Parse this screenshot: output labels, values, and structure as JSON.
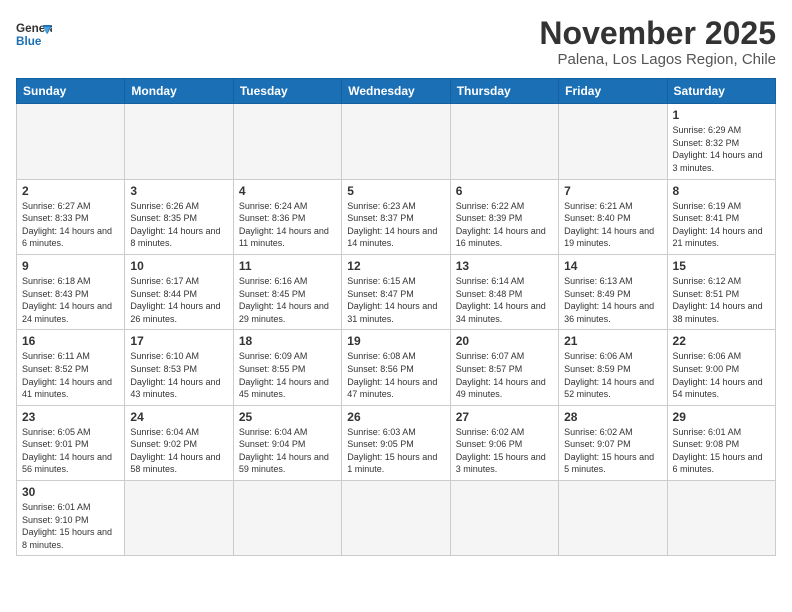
{
  "logo": {
    "general": "General",
    "blue": "Blue"
  },
  "header": {
    "month": "November 2025",
    "location": "Palena, Los Lagos Region, Chile"
  },
  "weekdays": [
    "Sunday",
    "Monday",
    "Tuesday",
    "Wednesday",
    "Thursday",
    "Friday",
    "Saturday"
  ],
  "weeks": [
    [
      {
        "day": "",
        "info": ""
      },
      {
        "day": "",
        "info": ""
      },
      {
        "day": "",
        "info": ""
      },
      {
        "day": "",
        "info": ""
      },
      {
        "day": "",
        "info": ""
      },
      {
        "day": "",
        "info": ""
      },
      {
        "day": "1",
        "info": "Sunrise: 6:29 AM\nSunset: 8:32 PM\nDaylight: 14 hours and 3 minutes."
      }
    ],
    [
      {
        "day": "2",
        "info": "Sunrise: 6:27 AM\nSunset: 8:33 PM\nDaylight: 14 hours and 6 minutes."
      },
      {
        "day": "3",
        "info": "Sunrise: 6:26 AM\nSunset: 8:35 PM\nDaylight: 14 hours and 8 minutes."
      },
      {
        "day": "4",
        "info": "Sunrise: 6:24 AM\nSunset: 8:36 PM\nDaylight: 14 hours and 11 minutes."
      },
      {
        "day": "5",
        "info": "Sunrise: 6:23 AM\nSunset: 8:37 PM\nDaylight: 14 hours and 14 minutes."
      },
      {
        "day": "6",
        "info": "Sunrise: 6:22 AM\nSunset: 8:39 PM\nDaylight: 14 hours and 16 minutes."
      },
      {
        "day": "7",
        "info": "Sunrise: 6:21 AM\nSunset: 8:40 PM\nDaylight: 14 hours and 19 minutes."
      },
      {
        "day": "8",
        "info": "Sunrise: 6:19 AM\nSunset: 8:41 PM\nDaylight: 14 hours and 21 minutes."
      }
    ],
    [
      {
        "day": "9",
        "info": "Sunrise: 6:18 AM\nSunset: 8:43 PM\nDaylight: 14 hours and 24 minutes."
      },
      {
        "day": "10",
        "info": "Sunrise: 6:17 AM\nSunset: 8:44 PM\nDaylight: 14 hours and 26 minutes."
      },
      {
        "day": "11",
        "info": "Sunrise: 6:16 AM\nSunset: 8:45 PM\nDaylight: 14 hours and 29 minutes."
      },
      {
        "day": "12",
        "info": "Sunrise: 6:15 AM\nSunset: 8:47 PM\nDaylight: 14 hours and 31 minutes."
      },
      {
        "day": "13",
        "info": "Sunrise: 6:14 AM\nSunset: 8:48 PM\nDaylight: 14 hours and 34 minutes."
      },
      {
        "day": "14",
        "info": "Sunrise: 6:13 AM\nSunset: 8:49 PM\nDaylight: 14 hours and 36 minutes."
      },
      {
        "day": "15",
        "info": "Sunrise: 6:12 AM\nSunset: 8:51 PM\nDaylight: 14 hours and 38 minutes."
      }
    ],
    [
      {
        "day": "16",
        "info": "Sunrise: 6:11 AM\nSunset: 8:52 PM\nDaylight: 14 hours and 41 minutes."
      },
      {
        "day": "17",
        "info": "Sunrise: 6:10 AM\nSunset: 8:53 PM\nDaylight: 14 hours and 43 minutes."
      },
      {
        "day": "18",
        "info": "Sunrise: 6:09 AM\nSunset: 8:55 PM\nDaylight: 14 hours and 45 minutes."
      },
      {
        "day": "19",
        "info": "Sunrise: 6:08 AM\nSunset: 8:56 PM\nDaylight: 14 hours and 47 minutes."
      },
      {
        "day": "20",
        "info": "Sunrise: 6:07 AM\nSunset: 8:57 PM\nDaylight: 14 hours and 49 minutes."
      },
      {
        "day": "21",
        "info": "Sunrise: 6:06 AM\nSunset: 8:59 PM\nDaylight: 14 hours and 52 minutes."
      },
      {
        "day": "22",
        "info": "Sunrise: 6:06 AM\nSunset: 9:00 PM\nDaylight: 14 hours and 54 minutes."
      }
    ],
    [
      {
        "day": "23",
        "info": "Sunrise: 6:05 AM\nSunset: 9:01 PM\nDaylight: 14 hours and 56 minutes."
      },
      {
        "day": "24",
        "info": "Sunrise: 6:04 AM\nSunset: 9:02 PM\nDaylight: 14 hours and 58 minutes."
      },
      {
        "day": "25",
        "info": "Sunrise: 6:04 AM\nSunset: 9:04 PM\nDaylight: 14 hours and 59 minutes."
      },
      {
        "day": "26",
        "info": "Sunrise: 6:03 AM\nSunset: 9:05 PM\nDaylight: 15 hours and 1 minute."
      },
      {
        "day": "27",
        "info": "Sunrise: 6:02 AM\nSunset: 9:06 PM\nDaylight: 15 hours and 3 minutes."
      },
      {
        "day": "28",
        "info": "Sunrise: 6:02 AM\nSunset: 9:07 PM\nDaylight: 15 hours and 5 minutes."
      },
      {
        "day": "29",
        "info": "Sunrise: 6:01 AM\nSunset: 9:08 PM\nDaylight: 15 hours and 6 minutes."
      }
    ],
    [
      {
        "day": "30",
        "info": "Sunrise: 6:01 AM\nSunset: 9:10 PM\nDaylight: 15 hours and 8 minutes."
      },
      {
        "day": "",
        "info": ""
      },
      {
        "day": "",
        "info": ""
      },
      {
        "day": "",
        "info": ""
      },
      {
        "day": "",
        "info": ""
      },
      {
        "day": "",
        "info": ""
      },
      {
        "day": "",
        "info": ""
      }
    ]
  ]
}
